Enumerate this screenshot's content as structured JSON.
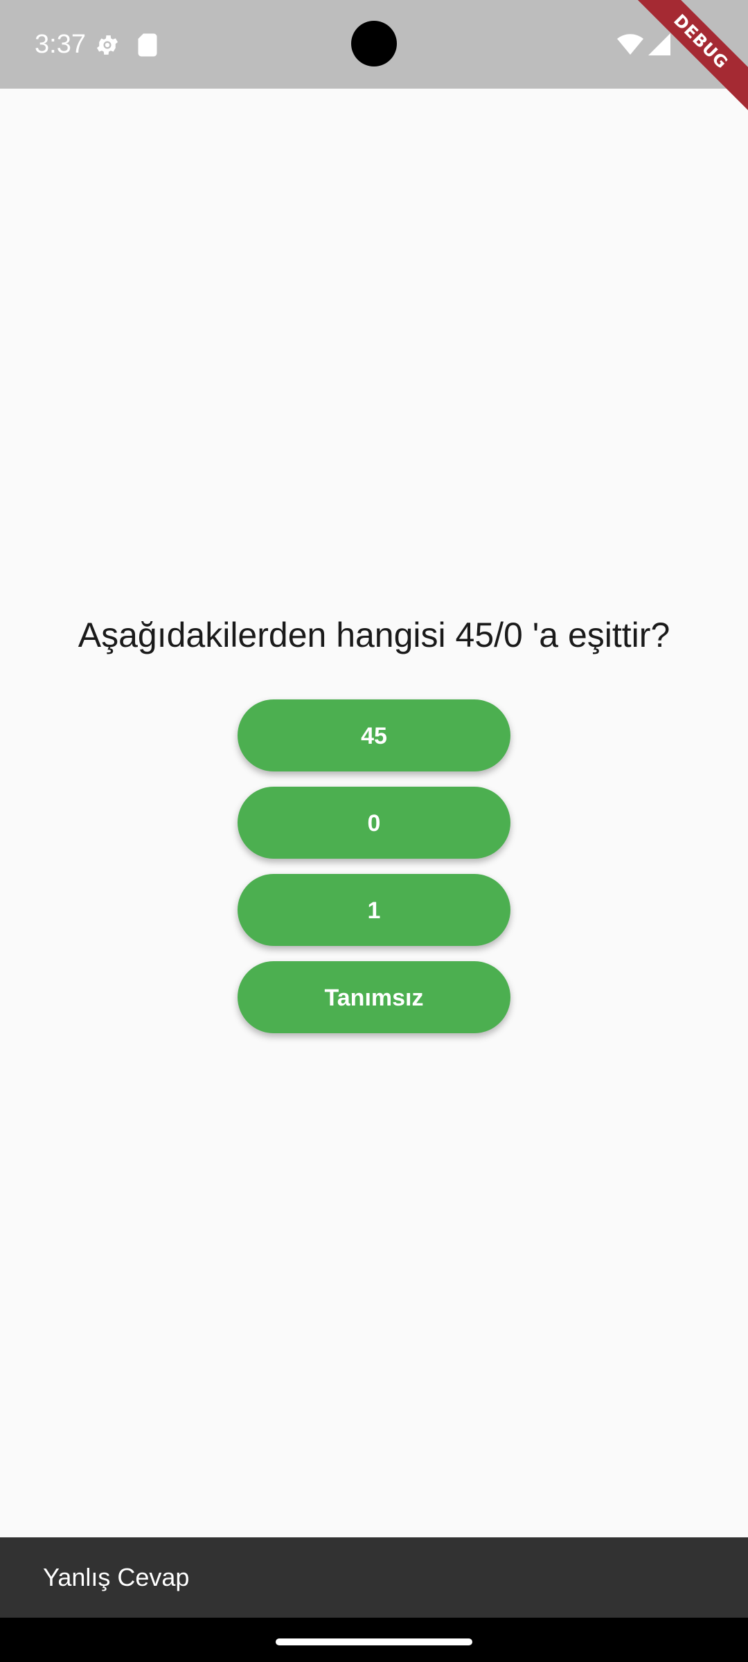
{
  "status_bar": {
    "time": "3:37",
    "icons": [
      "settings-gear-icon",
      "sd-card-icon",
      "wifi-icon",
      "cellular-signal-icon"
    ]
  },
  "debug_banner": "DEBUG",
  "question": "Aşağıdakilerden hangisi 45/0 'a eşittir?",
  "answers": [
    {
      "label": "45"
    },
    {
      "label": "0"
    },
    {
      "label": "1"
    },
    {
      "label": "Tanımsız"
    }
  ],
  "snackbar": {
    "message": "Yanlış Cevap"
  },
  "colors": {
    "button": "#4caf50",
    "status_bar": "#bdbdbd",
    "background": "#fafafa",
    "snackbar": "#323232",
    "debug_ribbon": "#a52a33"
  }
}
